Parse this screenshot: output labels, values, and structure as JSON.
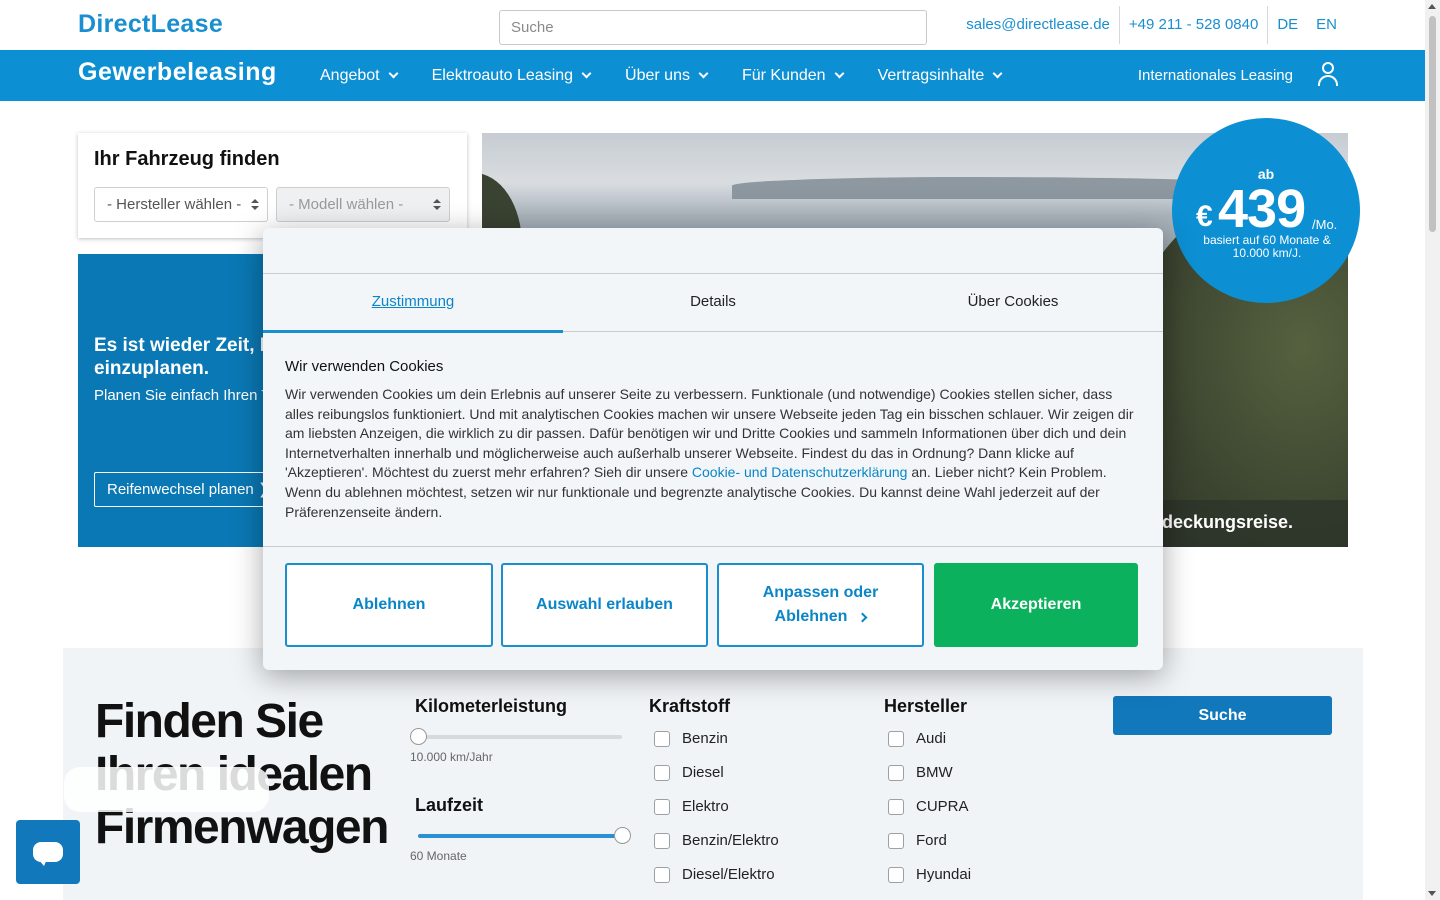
{
  "header": {
    "logo": "DirectLease",
    "search_placeholder": "Suche",
    "email": "sales@directlease.de",
    "phone": "+49 211 - 528 0840",
    "lang_de": "DE",
    "lang_en": "EN"
  },
  "nav": {
    "brand": "Gewerbeleasing",
    "items": [
      {
        "label": "Angebot"
      },
      {
        "label": "Elektroauto Leasing"
      },
      {
        "label": "Über uns"
      },
      {
        "label": "Für Kunden"
      },
      {
        "label": "Vertragsinhalte"
      }
    ],
    "international": "Internationales Leasing"
  },
  "finder": {
    "title": "Ihr Fahrzeug finden",
    "manufacturer": "- Hersteller wählen -",
    "model": "- Modell wählen -"
  },
  "promo": {
    "title": "Es ist wieder Zeit, Il\neinzuplanen.",
    "text": "Planen Sie einfach Ihren T",
    "button": "Reifenwechsel planen"
  },
  "hero": {
    "caption": "deckungsreise.",
    "price_prefix": "ab",
    "currency": "€",
    "amount": "439",
    "period": "/Mo.",
    "basis": "basiert auf 60 Monate & 10.000 km/J."
  },
  "cookie": {
    "tabs": [
      "Zustimmung",
      "Details",
      "Über Cookies"
    ],
    "heading": "Wir verwenden Cookies",
    "text_before": "Wir verwenden Cookies um dein Erlebnis auf unserer Seite zu verbessern. Funktionale (und notwendige) Cookies stellen sicher, dass alles reibungslos funktioniert. Und mit analytischen Cookies machen wir unsere Webseite jeden Tag ein bisschen schlauer. Wir zeigen dir am liebsten Anzeigen, die wirklich zu dir passen. Dafür benötigen wir und Dritte Cookies und sammeln Informationen über dich und dein Internetverhalten innerhalb und möglicherweise auch außerhalb unserer Webseite. Findest du das in Ordnung? Dann klicke auf 'Akzeptieren'. Möchtest du zuerst mehr erfahren? Sieh dir unsere ",
    "link": "Cookie- und Datenschutzerklärung",
    "text_after": " an. Lieber nicht? Kein Problem. Wenn du ablehnen möchtest, setzen wir nur funktionale und begrenzte analytische Cookies. Du kannst deine Wahl jederzeit auf der Präferenzenseite ändern.",
    "btn_reject": "Ablehnen",
    "btn_selection": "Auswahl erlauben",
    "btn_customize": "Anpassen oder Ablehnen",
    "btn_accept": "Akzeptieren"
  },
  "search_panel": {
    "heading": "Finden Sie Ihren idealen Firmenwagen",
    "mileage_title": "Kilometerleistung",
    "mileage_value": "10.000 km/Jahr",
    "mileage_level": 0,
    "term_title": "Laufzeit",
    "term_value": "60 Monate",
    "term_level": 1,
    "fuel_title": "Kraftstoff",
    "fuels": [
      "Benzin",
      "Diesel",
      "Elektro",
      "Benzin/Elektro",
      "Diesel/Elektro"
    ],
    "brand_title": "Hersteller",
    "brands": [
      "Audi",
      "BMW",
      "CUPRA",
      "Ford",
      "Hyundai"
    ],
    "search_button": "Suche"
  }
}
